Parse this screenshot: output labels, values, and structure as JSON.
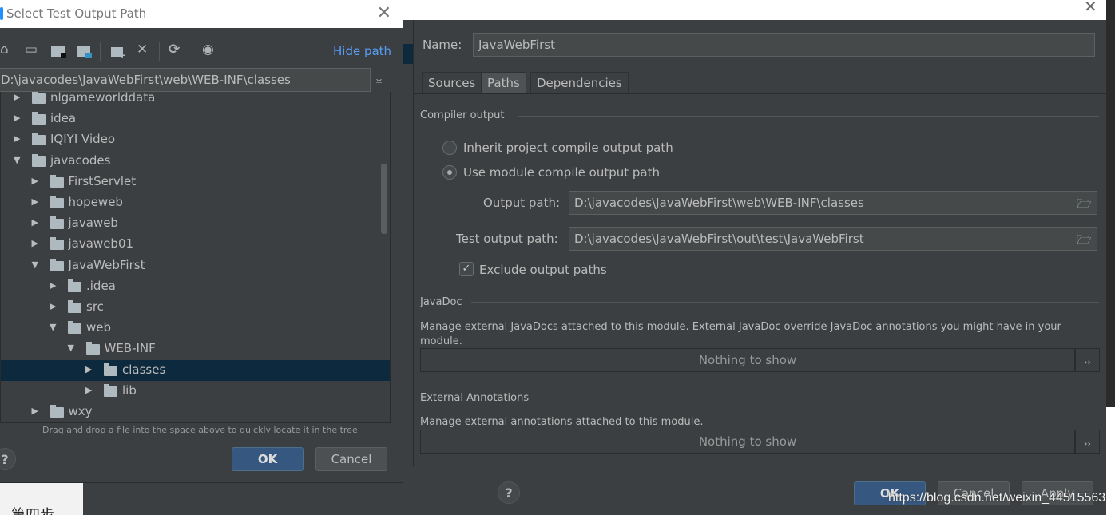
{
  "left_dialog": {
    "title": "Select Test Output Path",
    "toolbar": [
      "home-icon",
      "desktop-icon",
      "project-folder-icon",
      "module-folder-icon",
      "new-folder-icon",
      "delete-icon",
      "refresh-icon",
      "show-hidden-icon"
    ],
    "hide_path": "Hide path",
    "path": "D:\\javacodes\\JavaWebFirst\\web\\WEB-INF\\classes",
    "tree": [
      {
        "label": "nlgameworlddata",
        "level": 1,
        "expanded": false
      },
      {
        "label": "idea",
        "level": 1,
        "expanded": false
      },
      {
        "label": "IQIYI Video",
        "level": 1,
        "expanded": false
      },
      {
        "label": "javacodes",
        "level": 1,
        "expanded": true
      },
      {
        "label": "FirstServlet",
        "level": 2,
        "expanded": false
      },
      {
        "label": "hopeweb",
        "level": 2,
        "expanded": false
      },
      {
        "label": "javaweb",
        "level": 2,
        "expanded": false
      },
      {
        "label": "javaweb01",
        "level": 2,
        "expanded": false
      },
      {
        "label": "JavaWebFirst",
        "level": 2,
        "expanded": true
      },
      {
        "label": ".idea",
        "level": 3,
        "expanded": false
      },
      {
        "label": "src",
        "level": 3,
        "expanded": false
      },
      {
        "label": "web",
        "level": 3,
        "expanded": true
      },
      {
        "label": "WEB-INF",
        "level": 4,
        "expanded": true
      },
      {
        "label": "classes",
        "level": 5,
        "expanded": false,
        "selected": true
      },
      {
        "label": "lib",
        "level": 5,
        "expanded": false
      },
      {
        "label": "wxy",
        "level": 2,
        "expanded": false
      }
    ],
    "hint": "Drag and drop a file into the space above to quickly locate it in the tree",
    "ok": "OK",
    "cancel": "Cancel",
    "help": "?"
  },
  "background_text": "第四步",
  "right_dialog": {
    "name_label": "Name:",
    "name_value": "JavaWebFirst",
    "tabs": [
      "Sources",
      "Paths",
      "Dependencies"
    ],
    "active_tab": "Paths",
    "compiler_output": "Compiler output",
    "inherit": "Inherit project compile output path",
    "use_module": "Use module compile output path",
    "output_label": "Output path:",
    "output_value": "D:\\javacodes\\JavaWebFirst\\web\\WEB-INF\\classes",
    "test_label": "Test output path:",
    "test_value": "D:\\javacodes\\JavaWebFirst\\out\\test\\JavaWebFirst",
    "exclude": "Exclude output paths",
    "exclude_checked": true,
    "javadoc": "JavaDoc",
    "javadoc_desc": "Manage external JavaDocs attached to this module. External JavaDoc override JavaDoc annotations you might have in your module.",
    "nothing": "Nothing to show",
    "more": "››",
    "ext_ann": "External Annotations",
    "ext_desc": "Manage external annotations attached to this module.",
    "ok": "OK",
    "cancel": "Cancel",
    "apply": "Apply",
    "help": "?"
  },
  "watermark": "https://blog.csdn.net/weixin_44515563"
}
